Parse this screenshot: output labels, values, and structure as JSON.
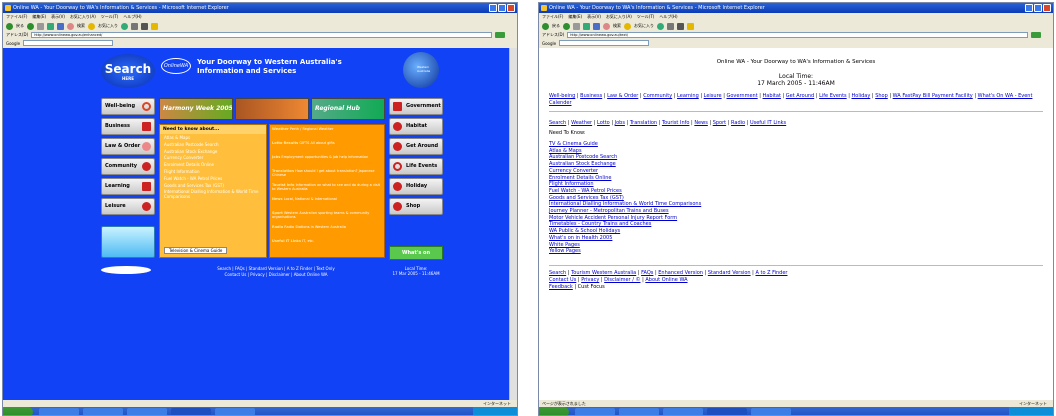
{
  "browser": {
    "title": "Online WA - Your Doorway to WA's Information & Services - Microsoft Internet Explorer",
    "menu": [
      "ファイル(F)",
      "編集(E)",
      "表示(V)",
      "お気に入り(A)",
      "ツール(T)",
      "ヘルプ(H)"
    ],
    "toolbar": {
      "back": "戻る",
      "search": "検索",
      "favorites": "お気に入り"
    },
    "address_label": "アドレス(D)",
    "address_left": "http://www.onlinewa.gov.au/enhanced/",
    "address_right": "http://www.onlinewa.gov.au/text/",
    "google_label": "Google",
    "status_left": "",
    "status_right": "インターネット",
    "status_right_page": "ページが表示されました"
  },
  "enhanced": {
    "search_logo": "Search",
    "search_logo_sub": "HERE",
    "ow_logo": "OnlineWA",
    "tagline": "Your Doorway to Western Australia's Information and Services",
    "globe_label": "Western Australia",
    "left_nav": [
      "Well-being",
      "Business",
      "Law & Order",
      "Community",
      "Learning",
      "Leisure"
    ],
    "right_nav": [
      "Government",
      "Habitat",
      "Get Around",
      "Life Events",
      "Holiday",
      "Shop"
    ],
    "banners": [
      "Harmony Week 2005",
      "",
      "Regional Hub"
    ],
    "ntk_title": "Need to know about...",
    "ntk_items": [
      "Atlas & Maps",
      "Australian Postcode Search",
      "Australian Stock Exchange",
      "Currency Converter",
      "Enrolment Details Online",
      "Flight Information",
      "Fuel Watch - WA Petrol Prices",
      "Goods and Services Tax (GST)",
      "International Dialling Information & World Time Comparisons"
    ],
    "ntk_select": "Television & Cinema Guide",
    "news": [
      {
        "head": "Weather",
        "text": "Perth / Regional Weather"
      },
      {
        "head": "Lotto Results",
        "text": "GIFTS All about gifts"
      },
      {
        "head": "Jobs",
        "text": "Employment opportunities & job help information"
      },
      {
        "head": "Translation",
        "text": "How should I get about translation? Japanese Chinese"
      },
      {
        "head": "Tourist Info",
        "text": "Information on what to see and do during a visit to Western Australia"
      },
      {
        "head": "News",
        "text": "Local, National & International"
      },
      {
        "head": "Sport",
        "text": "Western Australian sporting teams & community organisations"
      },
      {
        "head": "Radio",
        "text": "Radio Stations in Western Australia"
      },
      {
        "head": "Useful IT Links",
        "text": "IT, etc."
      }
    ],
    "whats_on": "What's on",
    "footer_links": "Search | FAQs | Standard Version | A to Z Finder | Text Only\nContact Us | Privacy | Disclaimer | About Online WA",
    "local_time": "Local Time:\n17 Mar 2005 - 11:46AM"
  },
  "standard": {
    "heading": "Online WA - Your Doorway to WA's Information & Services",
    "local_time_label": "Local Time:",
    "local_time_value": "17 March 2005 - 11:46AM",
    "nav_links": [
      "Well-being",
      "Business",
      "Law & Order",
      "Community",
      "Learning",
      "Leisure",
      "Government",
      "Habitat",
      "Get Around",
      "Life Events",
      "Holiday",
      "Shop",
      "WA FastPay Bill Payment Facility",
      "What's On WA - Event Calender"
    ],
    "quick_links": [
      "Search",
      "Weather",
      "Lotto",
      "Jobs",
      "Translation",
      "Tourist Info",
      "News",
      "Sport",
      "Radio",
      "Useful IT Links"
    ],
    "need_to_know": "Need To Know:",
    "ntk_items": [
      "TV & Cinema Guide",
      "Atlas & Maps",
      "Australian Postcode Search",
      "Australian Stock Exchange",
      "Currency Converter",
      "Enrolment Details Online",
      "Flight Information",
      "Fuel Watch - WA Petrol Prices",
      "Goods and Services Tax (GST)",
      "International Dialling Information & World Time Comparisons",
      "Journey Planner - Metropolitan Trains and Buses",
      "Motor Vehicle Accident Personal Injury Report Form",
      "Timetables - Country Trains and Coaches",
      "WA Public & School Holidays",
      "What's on in Health 2005",
      "White Pages",
      "Yellow Pages"
    ],
    "footer_links1": [
      "Search",
      "Tourism Western Australia",
      "FAQs",
      "Enhanced Version",
      "Standard Version",
      "A to Z Finder"
    ],
    "footer_links2": [
      "Contact Us",
      "Privacy",
      "Disclaimer / ©",
      "About Online WA"
    ],
    "footer_links3": "Feedback",
    "footer_text3": "| Cust Focus"
  },
  "colors": {
    "enhanced_bg": "#1142f6",
    "ntk_bg": "#ffbf3c",
    "news_bg": "#ff9a00",
    "link": "#0000cc"
  }
}
